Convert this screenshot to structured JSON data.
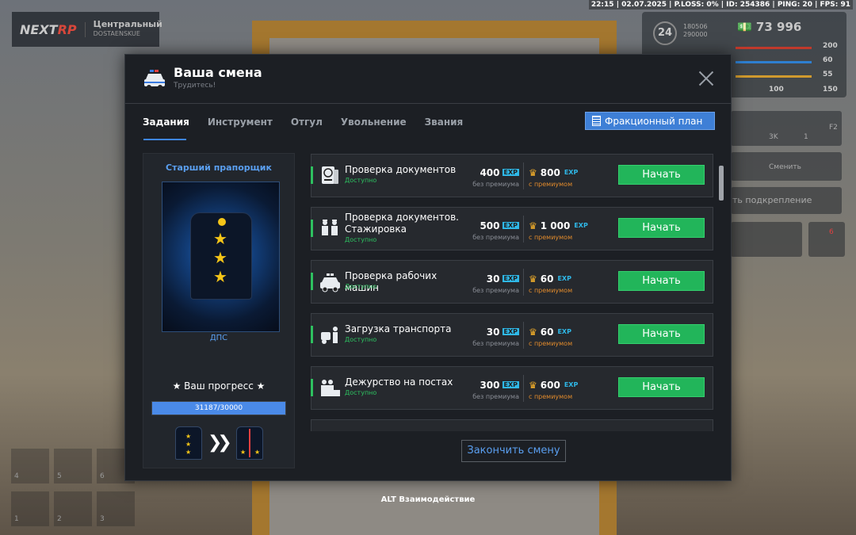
{
  "hud": {
    "top_status": "22:15 | 02.07.2025 | P.LOSS: 0% | ID: 254386 | PING: 20 | FPS: 91",
    "logo_main": "NEXT",
    "logo_accent": "RP",
    "location": "Центральный",
    "location_sub": "DOSTAENSKUE",
    "level": "24",
    "level_progress_top": "180506",
    "level_progress_bottom": "290000",
    "money": "73 996",
    "stats": [
      "200",
      "60",
      "55",
      "150"
    ],
    "stat_extra": "100",
    "side_counts": [
      "3K",
      "1"
    ],
    "side_key": "F2",
    "change_label": "Сменить",
    "reinforce_label": "ть подкрепление",
    "notif_count": "6",
    "slot_numbers": [
      "4",
      "5",
      "6",
      "1",
      "2",
      "3"
    ],
    "alt_hint": "ALT Взаимодействие"
  },
  "modal": {
    "title": "Ваша смена",
    "subtitle": "Трудитесь!",
    "tabs": [
      "Задания",
      "Инструмент",
      "Отгул",
      "Увольнение",
      "Звания"
    ],
    "plan_button": "Фракционный план",
    "end_button": "Закончить смену"
  },
  "rank": {
    "name": "Старший прапорщик",
    "department": "ДПС",
    "progress_label": "★ Ваш прогресс ★",
    "progress_text": "31187/30000",
    "progress_fraction": 1.0
  },
  "exp_tag": "EXP",
  "no_premium": "без премиума",
  "with_premium": "с премиумом",
  "tasks": [
    {
      "name": "Проверка документов",
      "status": "Доступно",
      "exp": "400",
      "exp_premium": "800",
      "button": "Начать",
      "icon": "passport-icon"
    },
    {
      "name": "Проверка документов. Стажировка",
      "status": "Доступно",
      "exp": "500",
      "exp_premium": "1 000",
      "button": "Начать",
      "icon": "officers-icon"
    },
    {
      "name": "Проверка рабочих машин",
      "status": "Доступно",
      "exp": "30",
      "exp_premium": "60",
      "button": "Начать",
      "icon": "police-car-icon"
    },
    {
      "name": "Загрузка транспорта",
      "status": "Доступно",
      "exp": "30",
      "exp_premium": "60",
      "button": "Начать",
      "icon": "tow-truck-icon"
    },
    {
      "name": "Дежурство на постах",
      "status": "Доступно",
      "exp": "300",
      "exp_premium": "600",
      "button": "Начать",
      "icon": "patrol-icon"
    }
  ]
}
